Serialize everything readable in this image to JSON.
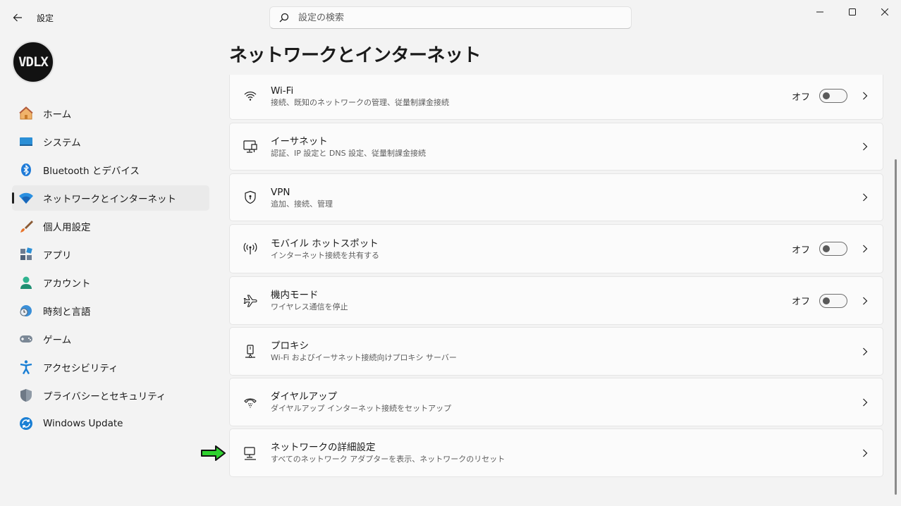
{
  "window": {
    "title": "設定"
  },
  "search": {
    "placeholder": "設定の検索"
  },
  "user": {
    "avatar_text": "VDLX"
  },
  "sidebar": {
    "items": [
      {
        "label": "ホーム",
        "icon": "home-icon"
      },
      {
        "label": "システム",
        "icon": "system-icon"
      },
      {
        "label": "Bluetooth とデバイス",
        "icon": "bluetooth-icon"
      },
      {
        "label": "ネットワークとインターネット",
        "icon": "network-icon",
        "active": true
      },
      {
        "label": "個人用設定",
        "icon": "brush-icon"
      },
      {
        "label": "アプリ",
        "icon": "apps-icon"
      },
      {
        "label": "アカウント",
        "icon": "account-icon"
      },
      {
        "label": "時刻と言語",
        "icon": "globe-clock-icon"
      },
      {
        "label": "ゲーム",
        "icon": "gamepad-icon"
      },
      {
        "label": "アクセシビリティ",
        "icon": "accessibility-icon"
      },
      {
        "label": "プライバシーとセキュリティ",
        "icon": "shield-icon"
      },
      {
        "label": "Windows Update",
        "icon": "update-icon"
      }
    ]
  },
  "main": {
    "title": "ネットワークとインターネット",
    "cards": [
      {
        "title": "Wi-Fi",
        "subtitle": "接続、既知のネットワークの管理、従量制課金接続",
        "state": "オフ",
        "icon": "wifi-icon"
      },
      {
        "title": "イーサネット",
        "subtitle": "認証、IP 設定と DNS 設定、従量制課金接続",
        "icon": "ethernet-icon"
      },
      {
        "title": "VPN",
        "subtitle": "追加、接続、管理",
        "icon": "vpn-shield-icon"
      },
      {
        "title": "モバイル ホットスポット",
        "subtitle": "インターネット接続を共有する",
        "state": "オフ",
        "icon": "hotspot-icon"
      },
      {
        "title": "機内モード",
        "subtitle": "ワイヤレス通信を停止",
        "state": "オフ",
        "icon": "airplane-icon"
      },
      {
        "title": "プロキシ",
        "subtitle": "Wi-Fi およびイーサネット接続向けプロキシ サーバー",
        "icon": "proxy-icon"
      },
      {
        "title": "ダイヤルアップ",
        "subtitle": "ダイヤルアップ インターネット接続をセットアップ",
        "icon": "dialup-icon"
      },
      {
        "title": "ネットワークの詳細設定",
        "subtitle": "すべてのネットワーク アダプターを表示、ネットワークのリセット",
        "icon": "advanced-network-icon"
      }
    ]
  },
  "colors": {
    "accent": "#0067c0",
    "arrow": "#22c322"
  }
}
